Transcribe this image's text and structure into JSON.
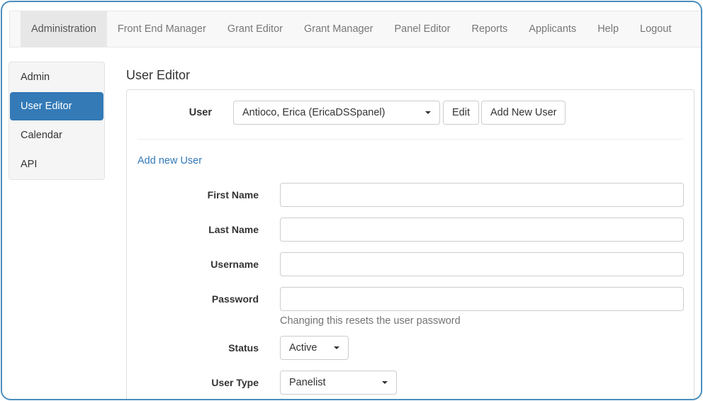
{
  "nav": {
    "items": [
      {
        "label": "Administration",
        "active": true
      },
      {
        "label": "Front End Manager"
      },
      {
        "label": "Grant Editor"
      },
      {
        "label": "Grant Manager"
      },
      {
        "label": "Panel Editor"
      },
      {
        "label": "Reports"
      },
      {
        "label": "Applicants"
      },
      {
        "label": "Help"
      },
      {
        "label": "Logout"
      }
    ]
  },
  "sidebar": {
    "items": [
      {
        "label": "Admin"
      },
      {
        "label": "User Editor",
        "active": true
      },
      {
        "label": "Calendar"
      },
      {
        "label": "API"
      }
    ]
  },
  "page": {
    "title": "User Editor"
  },
  "user_select": {
    "label": "User",
    "selected": "Antioco, Erica (EricaDSSpanel)",
    "edit_label": "Edit",
    "add_new_label": "Add New User"
  },
  "form": {
    "add_link": "Add new User",
    "first_name": {
      "label": "First Name",
      "value": ""
    },
    "last_name": {
      "label": "Last Name",
      "value": ""
    },
    "username": {
      "label": "Username",
      "value": ""
    },
    "password": {
      "label": "Password",
      "value": "",
      "help": "Changing this resets the user password"
    },
    "status": {
      "label": "Status",
      "selected": "Active"
    },
    "user_type": {
      "label": "User Type",
      "selected": "Panelist"
    }
  },
  "colors": {
    "accent": "#337ab7",
    "frame_border": "#4a8fbd",
    "nav_bg": "#f8f8f8",
    "nav_active_bg": "#e7e7e7"
  }
}
